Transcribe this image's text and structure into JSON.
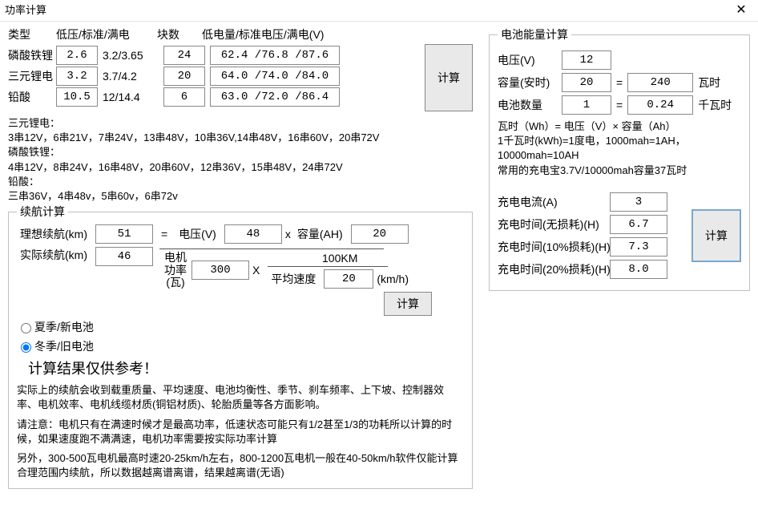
{
  "window": {
    "title": "功率计算"
  },
  "top": {
    "headers": {
      "type": "类型",
      "lvstd": "低压/标准/满电",
      "blocks": "块数",
      "voltstr": "低电量/标准电压/满电(V)"
    },
    "rows": [
      {
        "name": "磷酸铁锂",
        "v1": "2.6",
        "v2": "3.2/3.65",
        "blocks": "24",
        "vstr": "62.4 /76.8 /87.6"
      },
      {
        "name": "三元锂电",
        "v1": "3.2",
        "v2": "3.7/4.2",
        "blocks": "20",
        "vstr": "64.0 /74.0 /84.0"
      },
      {
        "name": "铅酸",
        "v1": "10.5",
        "v2": "12/14.4",
        "blocks": "6",
        "vstr": "63.0 /72.0 /86.4"
      }
    ],
    "calc": "计算",
    "notes_h1": "三元锂电：",
    "notes_l1": "3串12V，6串21V，7串24V，13串48V，10串36V,14串48V，16串60V，20串72V",
    "notes_h2": "磷酸铁锂：",
    "notes_l2": "4串12V，8串24V，16串48V，20串60V，12串36V，15串48V，24串72V",
    "notes_h3": "铅酸：",
    "notes_l3": "三串36V，4串48v，5串60v，6串72v"
  },
  "range": {
    "legend": "续航计算",
    "ideal_label": "理想续航(km)",
    "ideal": "51",
    "actual_label": "实际续航(km)",
    "actual": "46",
    "eq": "=",
    "volt_label": "电压(V)",
    "volt": "48",
    "times": "x",
    "cap_label": "容量(AH)",
    "cap": "20",
    "motor_label_top": "电机",
    "motor_label_mid": "功率",
    "motor_label_bot": "(瓦)",
    "motor": "300",
    "X": "X",
    "per100": "100KM",
    "avg_label": "平均速度",
    "avg": "20",
    "kmh": "(km/h)",
    "calc": "计算",
    "radio_summer": "夏季/新电池",
    "radio_winter": "冬季/旧电池",
    "result_hint": "计算结果仅供参考！",
    "p1": "实际上的续航会收到载重质量、平均速度、电池均衡性、季节、刹车频率、上下坡、控制器效率、电机效率、电机线缆材质(铜铝材质)、轮胎质量等各方面影响。",
    "p2": "请注意：电机只有在满速时候才是最高功率，低速状态可能只有1/2甚至1/3的功耗所以计算的时候，如果速度跑不满满速，电机功率需要按实际功率计算",
    "p3": "另外，300-500瓦电机最高时速20-25km/h左右，800-1200瓦电机一般在40-50km/h软件仅能计算合理范围内续航，所以数据越离谱离谱，结果越离谱(无语)"
  },
  "energy": {
    "legend": "电池能量计算",
    "volt_label": "电压(V)",
    "volt": "12",
    "cap_label": "容量(安时)",
    "cap": "20",
    "eq": "=",
    "wh": "240",
    "wh_u": "瓦时",
    "qty_label": "电池数量",
    "qty": "1",
    "kwh": "0.24",
    "kwh_u": "千瓦时",
    "info1": "瓦时（Wh）= 电压（V）× 容量（Ah）",
    "info2": "1千瓦时(kWh)=1度电，1000mah=1AH，10000mah=10AH",
    "info3": "常用的充电宝3.7V/10000mah容量37瓦时",
    "cc_label": "充电电流(A)",
    "cc": "3",
    "t0_label": "充电时间(无损耗)(H)",
    "t0": "6.7",
    "t1_label": "充电时间(10%损耗)(H)",
    "t1": "7.3",
    "t2_label": "充电时间(20%损耗)(H)",
    "t2": "8.0",
    "calc": "计算"
  }
}
